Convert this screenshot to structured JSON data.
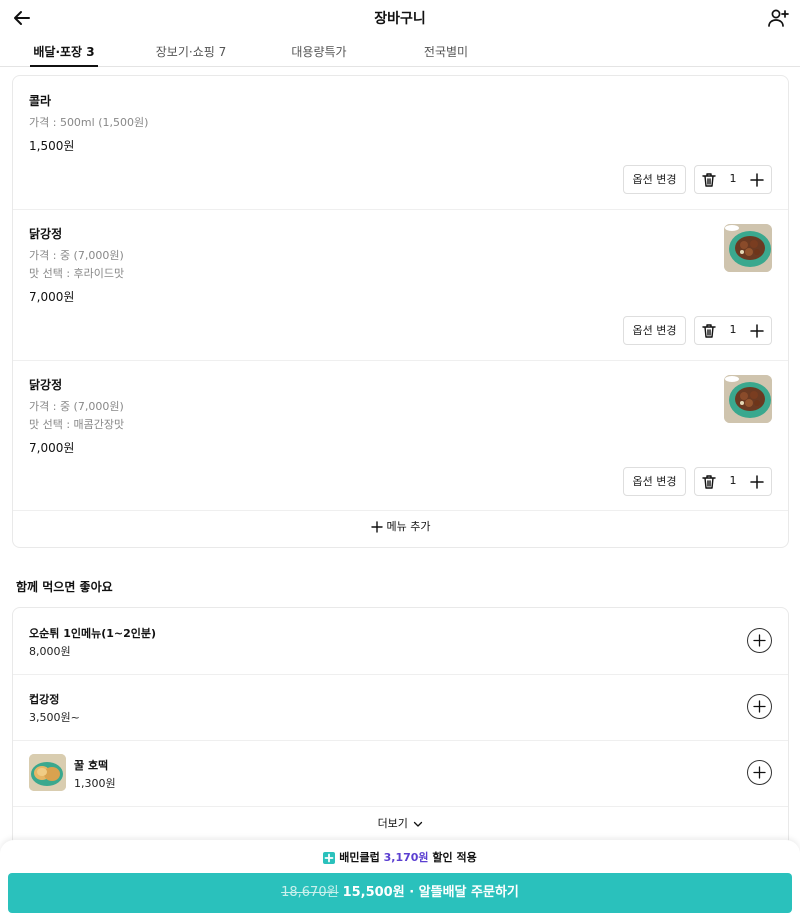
{
  "header": {
    "title": "장바구니",
    "back_icon": "arrow-left-icon",
    "add_user_icon": "person-add-icon"
  },
  "tabs": [
    {
      "label": "배달·포장 3",
      "active": true
    },
    {
      "label": "장보기·쇼핑 7",
      "active": false
    },
    {
      "label": "대용량특가",
      "active": false
    },
    {
      "label": "전국별미",
      "active": false
    }
  ],
  "cart": {
    "items": [
      {
        "name": "콜라",
        "details": [
          "가격 : 500ml (1,500원)"
        ],
        "price": "1,500원",
        "has_image": false,
        "quantity": "1",
        "option_label": "옵션 변경"
      },
      {
        "name": "닭강정",
        "details": [
          "가격 : 중 (7,000원)",
          "맛 선택 : 후라이드맛"
        ],
        "price": "7,000원",
        "has_image": true,
        "quantity": "1",
        "option_label": "옵션 변경"
      },
      {
        "name": "닭강정",
        "details": [
          "가격 : 중 (7,000원)",
          "맛 선택 : 매콤간장맛"
        ],
        "price": "7,000원",
        "has_image": true,
        "quantity": "1",
        "option_label": "옵션 변경"
      }
    ],
    "add_menu_label": "메뉴 추가"
  },
  "recommend": {
    "title": "함께 먹으면 좋아요",
    "items": [
      {
        "name": "오순튀 1인메뉴(1~2인분)",
        "price": "8,000원",
        "has_image": false
      },
      {
        "name": "컵강정",
        "price": "3,500원~",
        "has_image": false
      },
      {
        "name": "꿀 호떡",
        "price": "1,300원",
        "has_image": true
      }
    ],
    "more_label": "더보기"
  },
  "bottom": {
    "club_prefix": "배민클럽",
    "club_amount": "3,170원",
    "club_suffix": "할인 적용",
    "original_price": "18,670원",
    "order_label": "15,500원 · 알뜰배달 주문하기"
  },
  "colors": {
    "accent": "#2ac1bc",
    "club_purple": "#5b3fd1"
  }
}
